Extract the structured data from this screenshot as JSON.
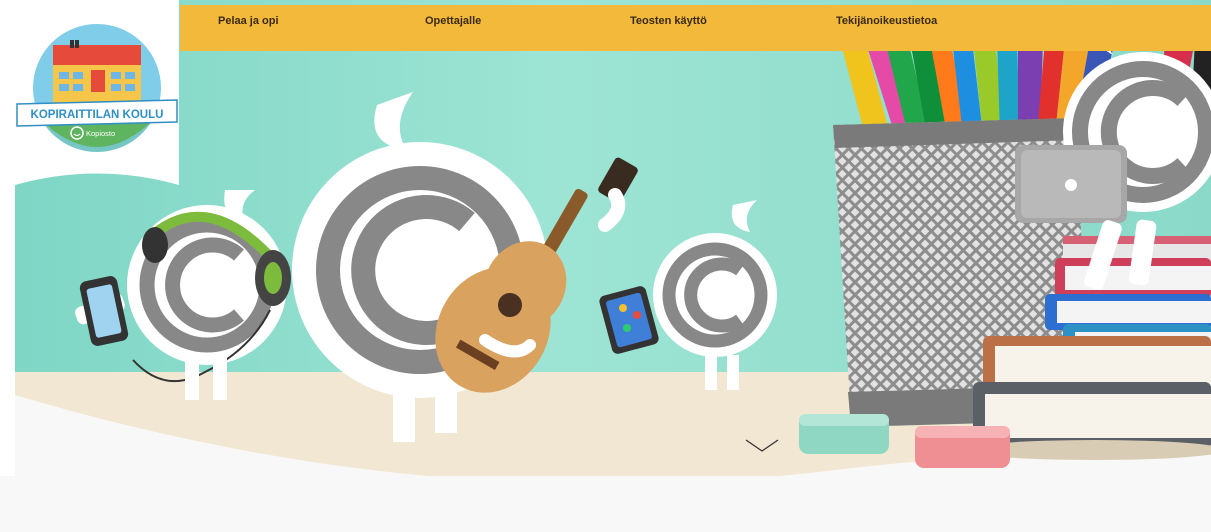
{
  "logo": {
    "title": "KOPIRAITTILAN KOULU",
    "brand": "Kopiosto"
  },
  "nav": {
    "items": [
      {
        "label": "Pelaa ja opi"
      },
      {
        "label": "Opettajalle"
      },
      {
        "label": "Teosten käyttö"
      },
      {
        "label": "Tekijänoikeustietoa"
      }
    ]
  },
  "colors": {
    "nav_bg": "#f2b93b",
    "wall": "#8ddccb",
    "table": "#f1e5cf",
    "logo_green": "#5eb45f",
    "logo_banner": "#2f8fc4"
  },
  "icons": {
    "scroll": "chevron-down-icon",
    "character_symbol": "copyright-icon"
  }
}
